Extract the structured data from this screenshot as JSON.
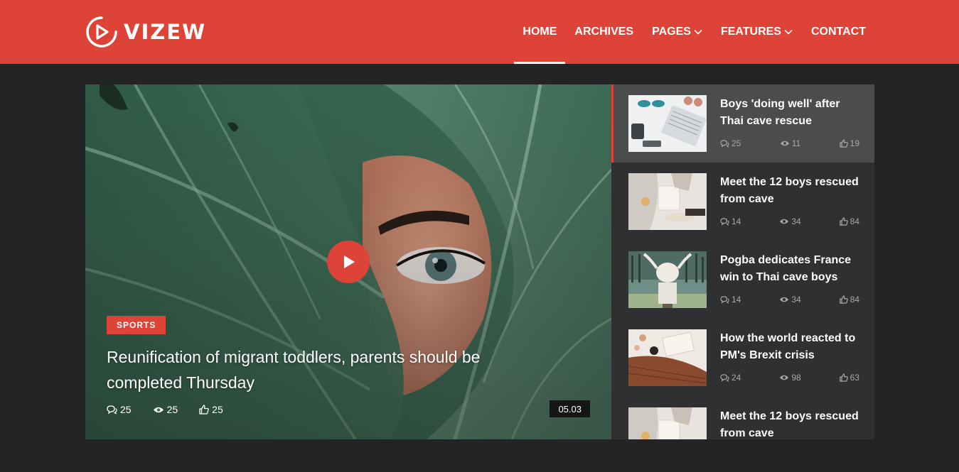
{
  "logo": {
    "text": "VIZEW",
    "icon": "play-circle-icon"
  },
  "nav": {
    "items": [
      {
        "label": "HOME",
        "active": true,
        "dropdown": false
      },
      {
        "label": "ARCHIVES",
        "active": false,
        "dropdown": false
      },
      {
        "label": "PAGES",
        "active": false,
        "dropdown": true
      },
      {
        "label": "FEATURES",
        "active": false,
        "dropdown": true
      },
      {
        "label": "CONTACT",
        "active": false,
        "dropdown": false
      }
    ]
  },
  "featured": {
    "category": "SPORTS",
    "title": "Reunification of migrant toddlers, parents should be completed Thursday",
    "comments": "25",
    "views": "25",
    "likes": "25",
    "duration": "05.03"
  },
  "sidebar": {
    "items": [
      {
        "title": "Boys 'doing well' after Thai cave rescue",
        "comments": "25",
        "views": "11",
        "likes": "19"
      },
      {
        "title": "Meet the 12 boys rescued from cave",
        "comments": "14",
        "views": "34",
        "likes": "84"
      },
      {
        "title": "Pogba dedicates France win to Thai cave boys",
        "comments": "14",
        "views": "34",
        "likes": "84"
      },
      {
        "title": "How the world reacted to PM's Brexit crisis",
        "comments": "24",
        "views": "98",
        "likes": "63"
      },
      {
        "title": "Meet the 12 boys rescued from cave",
        "comments": "",
        "views": "",
        "likes": ""
      }
    ]
  },
  "colors": {
    "brand": "#dd4437",
    "background": "#222425",
    "sidebar": "#2e3031",
    "sidebar_active": "#4a4c4d"
  }
}
